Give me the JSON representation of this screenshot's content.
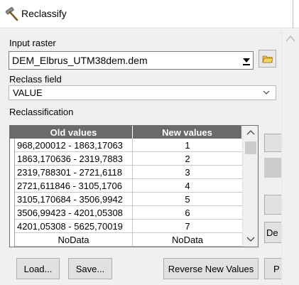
{
  "window": {
    "title": "Reclassify",
    "icon": "hammer-icon"
  },
  "input_raster": {
    "label": "Input raster",
    "value": "DEM_Elbrus_UTM38dem.dem",
    "browse_icon": "open-folder-icon"
  },
  "reclass_field": {
    "label": "Reclass field",
    "value": "VALUE"
  },
  "reclassification": {
    "label": "Reclassification",
    "columns": [
      "Old values",
      "New values"
    ],
    "rows": [
      {
        "old": "968,200012 - 1863,17063",
        "new": "1"
      },
      {
        "old": "1863,170636 - 2319,7883",
        "new": "2"
      },
      {
        "old": "2319,788301 - 2721,6118",
        "new": "3"
      },
      {
        "old": "2721,611846 - 3105,1706",
        "new": "4"
      },
      {
        "old": "3105,170684 - 3506,9942",
        "new": "5"
      },
      {
        "old": "3506,99423 - 4201,05308",
        "new": "6"
      },
      {
        "old": "4201,05308 - 5625,70019",
        "new": "7"
      },
      {
        "old": "NoData",
        "new": "NoData"
      }
    ]
  },
  "side_buttons": {
    "delete_partial": "De"
  },
  "buttons": {
    "load": "Load...",
    "save": "Save...",
    "reverse": "Reverse New Values",
    "precision_partial": "P"
  }
}
